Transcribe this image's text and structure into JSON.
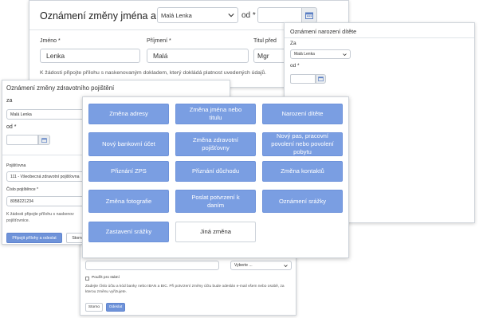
{
  "name_card": {
    "title": "Oznámení změny jména a titulu za",
    "person_select": "Malá Lenka",
    "od_label": "od *",
    "first_name_label": "Jméno *",
    "first_name_value": "Lenka",
    "last_name_label": "Příjmení *",
    "last_name_value": "Malá",
    "title_before_label": "Titul před",
    "title_before_value": "Mgr",
    "note": "K žádosti připojte přílohu s naskenovaným dokladem, který dokládá platnost uvedených údajů."
  },
  "birth_card": {
    "title": "Oznámení narození dítěte",
    "za_label": "Za",
    "person_select": "Malá Lenka",
    "od_label": "od *"
  },
  "insurance_card": {
    "title": "Oznámení změny zdravotního pojištění",
    "za_label": "za",
    "person_select": "Malá Lenka",
    "od_label": "od *",
    "insurer_label": "Pojišťovna",
    "insurer_value": "111 - Všeobecná zdravotní pojišťovna",
    "insured_no_label": "Číslo pojištěnce *",
    "insured_no_value": "8058221234",
    "note_line1": "K žádosti připojte přílohu s naskenov",
    "note_line2": "pojišťovnice.",
    "attach_button": "Připojit přílohy a odeslat",
    "cancel_button": "Storno"
  },
  "bank_card": {
    "title_fragment": "O",
    "select_placeholder": "Vyberte ...",
    "use_for_all_label": "Použít pro státní",
    "note": "Zadejte číslo účtu a kód banky nebo IBAN a BIC. Při potvrzení změny účtu bude odeslán e-mail všem nebo osobě, za kterou změnu vyřizujete.",
    "cancel_button": "Storno",
    "submit_button": "Odeslat"
  },
  "menu": {
    "tiles": [
      {
        "label": "Změna adresy",
        "style": "blue"
      },
      {
        "label": "Změna jména nebo titulu",
        "style": "blue"
      },
      {
        "label": "Narození dítěte",
        "style": "blue"
      },
      {
        "label": "Nový bankovní účet",
        "style": "blue"
      },
      {
        "label": "Změna zdravotní pojišťovny",
        "style": "blue"
      },
      {
        "label": "Nový pas, pracovní povolení nebo povolení pobytu",
        "style": "blue"
      },
      {
        "label": "Přiznání ZPS",
        "style": "blue"
      },
      {
        "label": "Přiznání důchodu",
        "style": "blue"
      },
      {
        "label": "Změna kontaktů",
        "style": "blue"
      },
      {
        "label": "Změna fotografie",
        "style": "blue"
      },
      {
        "label": "Poslat potvrzení k daním",
        "style": "blue"
      },
      {
        "label": "Oznámení srážky",
        "style": "blue"
      },
      {
        "label": "Zastavení srážky",
        "style": "blue"
      },
      {
        "label": "Jiná změna",
        "style": "white"
      }
    ]
  },
  "colors": {
    "tile_blue": "#7a9ee2",
    "button_primary": "#6f93d9"
  }
}
